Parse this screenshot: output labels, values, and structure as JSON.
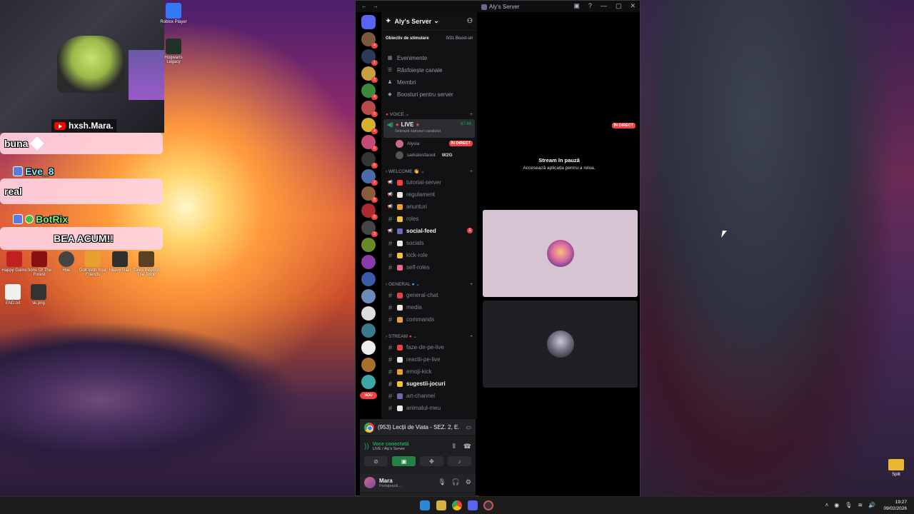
{
  "webcam": {
    "channel_name": "hxsh.Mara."
  },
  "chat": [
    {
      "user": "",
      "text": "buna"
    },
    {
      "user": "Eve_8",
      "text": "real"
    },
    {
      "user": "BotRix",
      "text": "BEA ACUM!!"
    }
  ],
  "desktop_icons": [
    {
      "label": "Roblox Player"
    },
    {
      "label": "Hogwarts Legacy"
    },
    {
      "label": "Happy Game"
    },
    {
      "label": "Sons Of The Forest"
    },
    {
      "label": "Hue"
    },
    {
      "label": "Golf With Your Friends"
    },
    {
      "label": "Heavy Rain"
    },
    {
      "label": "Tales Beyond The Tomb"
    },
    {
      "label": "END.txt"
    },
    {
      "label": "sk.png"
    },
    {
      "label": "Split"
    }
  ],
  "window": {
    "title": "Aly's Server"
  },
  "server": {
    "name": "Aly's Server",
    "boost_label": "Obiectiv de stimulare",
    "boost_progress": "0/31 Boost-uri",
    "menu": [
      "Evenimente",
      "Răsfoiește canale",
      "Membri",
      "Boosturi pentru server"
    ]
  },
  "categories": {
    "voice": "VOICE",
    "welcome": "WELCOME",
    "general": "GENERAL",
    "stream": "STREAM"
  },
  "voice_channel": {
    "name": "LIVE",
    "status": "Setează statusul canalului",
    "timer": "67:46",
    "users": [
      {
        "name": "Alysia",
        "badge": "ÎN DIRECT"
      },
      {
        "name": "sarkalesfaceit",
        "badge": "W2G"
      }
    ]
  },
  "welcome_channels": [
    "tutorial-server",
    "regulament",
    "anunturi",
    "roles",
    "social-feed",
    "socials",
    "kick-role",
    "self-roles"
  ],
  "social_feed_unread": "1",
  "general_channels": [
    "general-chat",
    "media",
    "commands"
  ],
  "stream_channels": [
    "faze-de-pe-live",
    "reactii-pe-live",
    "emoji-kick",
    "sugestii-jocuri",
    "art-channel",
    "animalul-meu"
  ],
  "rail_badges": [
    "4",
    "1",
    "3",
    "4",
    "6",
    "4",
    "6",
    "8",
    "2",
    "8",
    "6",
    "3"
  ],
  "rail_new": "NOU",
  "now_playing": "(953) Lecții de Viata - SEZ. 2, E...",
  "voice_connection": {
    "status": "Voce conectată",
    "where": "LIVE / Aly's Server"
  },
  "user": {
    "name": "Mara",
    "status": "Partajează ..."
  },
  "stream": {
    "live_badge": "ÎN DIRECT",
    "paused_title": "Stream în pauză",
    "paused_sub": "Accesează aplicația pentru a relua."
  },
  "taskbar": {
    "time": "19:27",
    "date": "09/02/2026"
  }
}
